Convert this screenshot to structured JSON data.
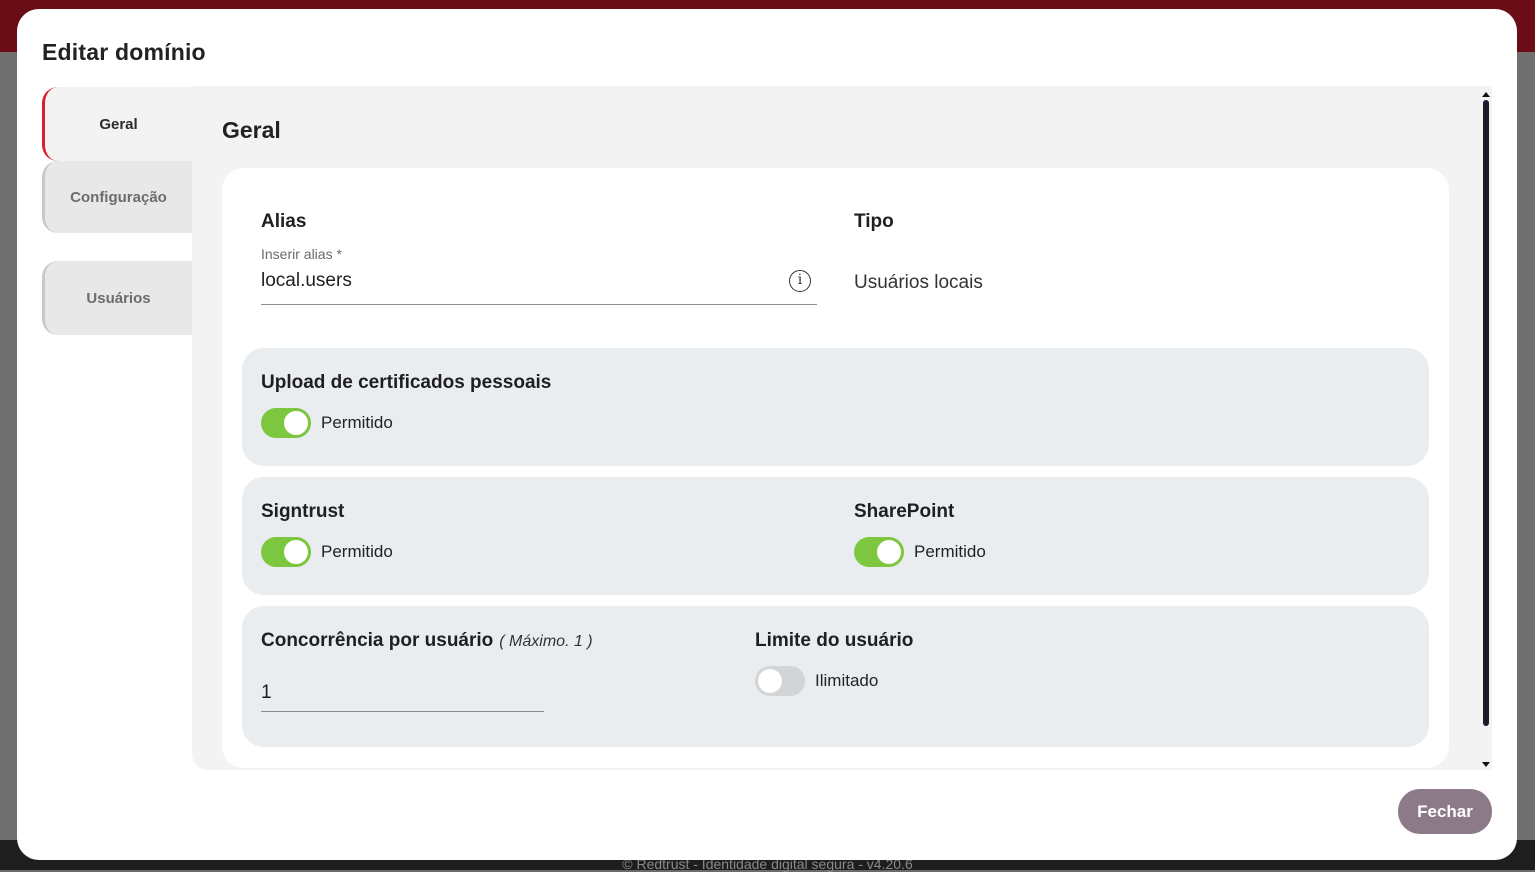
{
  "background": {
    "footer_text": "© Redtrust - Identidade digital segura - v4.20.6"
  },
  "modal": {
    "title": "Editar domínio",
    "tabs": [
      {
        "label": "Geral",
        "active": true
      },
      {
        "label": "Configuração",
        "active": false
      },
      {
        "label": "Usuários",
        "active": false
      }
    ],
    "section_title": "Geral",
    "alias": {
      "label": "Alias",
      "placeholder": "Inserir alias *",
      "value": "local.users",
      "icon": "info-icon"
    },
    "tipo": {
      "label": "Tipo",
      "value": "Usuários locais"
    },
    "upload_certificados": {
      "label": "Upload de certificados pessoais",
      "toggle_label": "Permitido",
      "enabled": true
    },
    "signtrust": {
      "label": "Signtrust",
      "toggle_label": "Permitido",
      "enabled": true
    },
    "sharepoint": {
      "label": "SharePoint",
      "toggle_label": "Permitido",
      "enabled": true
    },
    "concorrencia": {
      "label": "Concorrência por usuário",
      "hint": "( Máximo. 1 )",
      "value": "1"
    },
    "limite": {
      "label": "Limite do usuário",
      "toggle_label": "Ilimitado",
      "enabled": false
    },
    "close_button": "Fechar"
  },
  "colors": {
    "accent_red": "#d8202f",
    "toggle_on": "#7dc740",
    "close_button": "#8c7a89"
  }
}
